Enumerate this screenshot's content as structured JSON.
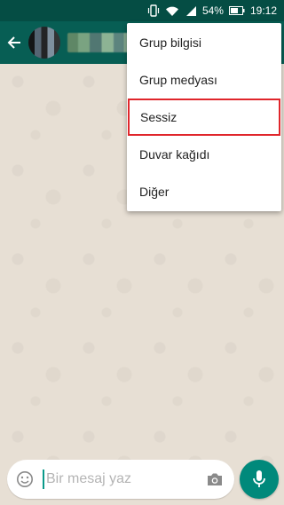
{
  "status_bar": {
    "battery_percent": "54%",
    "time": "19:12"
  },
  "app_bar": {
    "title_obscured": true
  },
  "menu": {
    "items": [
      {
        "label": "Grup bilgisi"
      },
      {
        "label": "Grup medyası"
      },
      {
        "label": "Sessiz",
        "highlighted": true
      },
      {
        "label": "Duvar kağıdı"
      },
      {
        "label": "Diğer"
      }
    ],
    "highlight_color": "#e0262b"
  },
  "composer": {
    "placeholder": "Bir mesaj yaz"
  },
  "colors": {
    "app_bar": "#075e54",
    "status_bar": "#054d44",
    "accent": "#00897b",
    "chat_background": "#e7dfd4"
  },
  "icons": [
    "vibrate-icon",
    "wifi-icon",
    "signal-icon",
    "battery-icon",
    "back-arrow-icon",
    "emoji-icon",
    "camera-icon",
    "mic-icon"
  ]
}
